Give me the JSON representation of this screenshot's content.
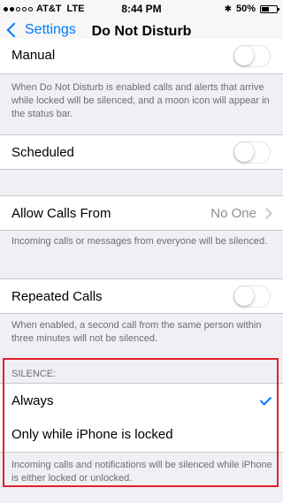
{
  "status_bar": {
    "carrier": "AT&T",
    "network": "LTE",
    "time": "8:44 PM",
    "battery": "50%",
    "signal_bars_filled": 2,
    "battery_level": 0.5
  },
  "nav": {
    "back_label": "Settings",
    "title": "Do Not Disturb"
  },
  "manual": {
    "label": "Manual",
    "on": false,
    "footer": "When Do Not Disturb is enabled calls and alerts that arrive while locked will be silenced, and a moon icon will appear in the status bar."
  },
  "scheduled": {
    "label": "Scheduled",
    "on": false
  },
  "allow_calls": {
    "label": "Allow Calls From",
    "value": "No One",
    "footer": "Incoming calls or messages from everyone will be silenced."
  },
  "repeated_calls": {
    "label": "Repeated Calls",
    "on": false,
    "footer": "When enabled, a second call from the same person within three minutes will not be silenced."
  },
  "silence": {
    "header": "SILENCE:",
    "options": [
      {
        "label": "Always",
        "selected": true
      },
      {
        "label": "Only while iPhone is locked",
        "selected": false
      }
    ],
    "footer": "Incoming calls and notifications will be silenced while iPhone is either locked or unlocked."
  },
  "colors": {
    "accent": "#007aff",
    "highlight": "#e0212c",
    "background": "#efeff4"
  }
}
